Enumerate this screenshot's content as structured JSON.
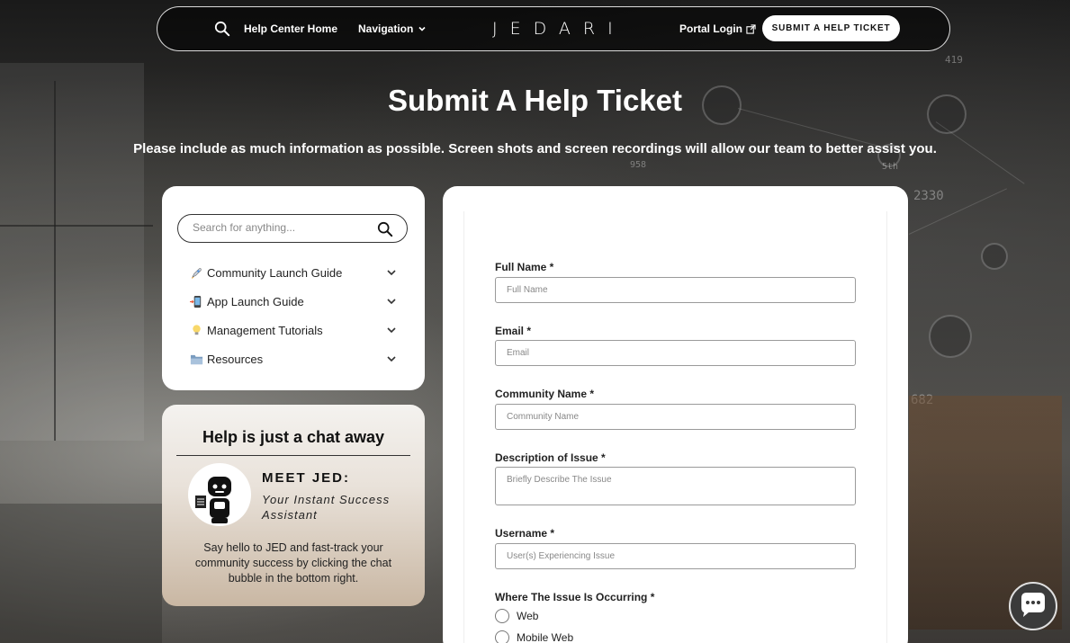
{
  "header": {
    "home_label": "Help Center Home",
    "navigation_label": "Navigation",
    "logo_text": "JEDARI",
    "portal_label": "Portal Login",
    "submit_label": "SUBMIT A HELP TICKET"
  },
  "page": {
    "title": "Submit A Help Ticket",
    "subtitle": "Please include as much information as possible. Screen shots and screen recordings will allow our team to better assist you."
  },
  "sidebar": {
    "search_placeholder": "Search for anything...",
    "items": [
      {
        "label": "Community Launch Guide",
        "icon": "rocket-icon"
      },
      {
        "label": "App Launch Guide",
        "icon": "mobile-phone-icon"
      },
      {
        "label": "Management Tutorials",
        "icon": "lightbulb-icon"
      },
      {
        "label": "Resources",
        "icon": "folder-icon"
      }
    ]
  },
  "chat_card": {
    "title": "Help is just a chat away",
    "meet": "MEET JED:",
    "meet_sub": "Your Instant Success Assistant",
    "description": "Say hello to JED and fast-track your community success by clicking the chat bubble in the bottom right."
  },
  "form": {
    "fields": [
      {
        "label": "Full Name *",
        "placeholder": "Full Name"
      },
      {
        "label": "Email *",
        "placeholder": "Email"
      },
      {
        "label": "Community Name *",
        "placeholder": "Community Name"
      },
      {
        "label": "Description of Issue *",
        "placeholder": "Briefly Describe The Issue"
      },
      {
        "label": "Username *",
        "placeholder": "User(s) Experiencing Issue"
      }
    ],
    "occurring_label": "Where The Issue Is Occurring *",
    "options": [
      "Web",
      "Mobile Web"
    ]
  },
  "background": {
    "numbers": [
      "2330",
      "682",
      "958",
      "5th",
      "419"
    ]
  }
}
